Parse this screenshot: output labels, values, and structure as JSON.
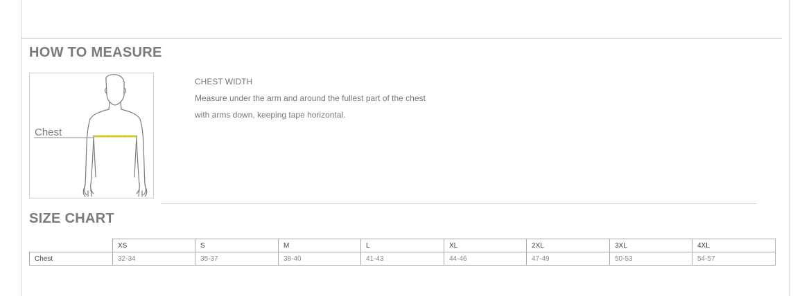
{
  "measure_section": {
    "title": "HOW TO MEASURE",
    "figure_label": "Chest",
    "heading": "CHEST WIDTH",
    "lines": [
      "Measure under the arm and around the fullest part of the chest",
      "with arms down, keeping tape horizontal."
    ]
  },
  "size_chart": {
    "title": "SIZE CHART",
    "headers": [
      "XS",
      "S",
      "M",
      "L",
      "XL",
      "2XL",
      "3XL",
      "4XL"
    ],
    "rows": [
      {
        "label": "Chest",
        "values": [
          "32-34",
          "35-37",
          "38-40",
          "41-43",
          "44-46",
          "47-49",
          "50-53",
          "54-57"
        ]
      }
    ]
  },
  "colors": {
    "tape": "#d9cf33",
    "text": "#777777",
    "border": "#aaaaaa"
  }
}
